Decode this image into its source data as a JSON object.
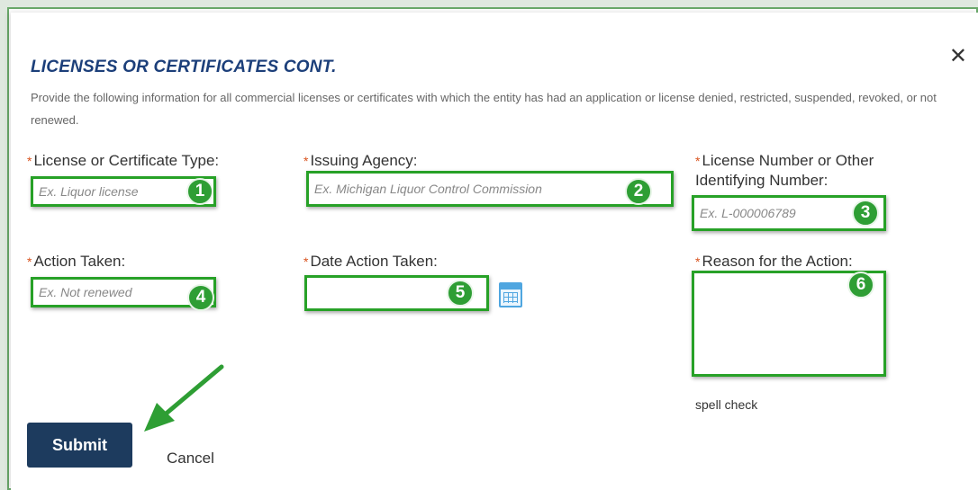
{
  "dialog": {
    "title": "LICENSES OR CERTIFICATES CONT.",
    "description": "Provide the following information for all commercial licenses or certificates with which the entity has had an application or license denied, restricted, suspended, revoked, or not renewed.",
    "close_icon": "close-icon"
  },
  "required_marker": "*",
  "fields": {
    "license_type": {
      "label": "License or Certificate Type:",
      "placeholder": "Ex. Liquor license",
      "badge": "1"
    },
    "issuing_agency": {
      "label": "Issuing Agency:",
      "placeholder": "Ex. Michigan Liquor Control Commission",
      "badge": "2"
    },
    "license_number": {
      "label": "License Number or Other Identifying Number:",
      "placeholder": "Ex. L-000006789",
      "badge": "3"
    },
    "action_taken": {
      "label": "Action Taken:",
      "placeholder": "Ex. Not renewed",
      "badge": "4"
    },
    "date_action": {
      "label": "Date Action Taken:",
      "placeholder": "",
      "badge": "5",
      "icon": "calendar-icon"
    },
    "reason": {
      "label": "Reason for the Action:",
      "placeholder": "",
      "badge": "6"
    }
  },
  "spell_check": "spell check",
  "buttons": {
    "submit": "Submit",
    "cancel": "Cancel"
  },
  "colors": {
    "title": "#1c3f7a",
    "highlight": "#27a127",
    "badge": "#2e9e34",
    "submit_bg": "#1d3b5e",
    "required": "#d9531e"
  }
}
